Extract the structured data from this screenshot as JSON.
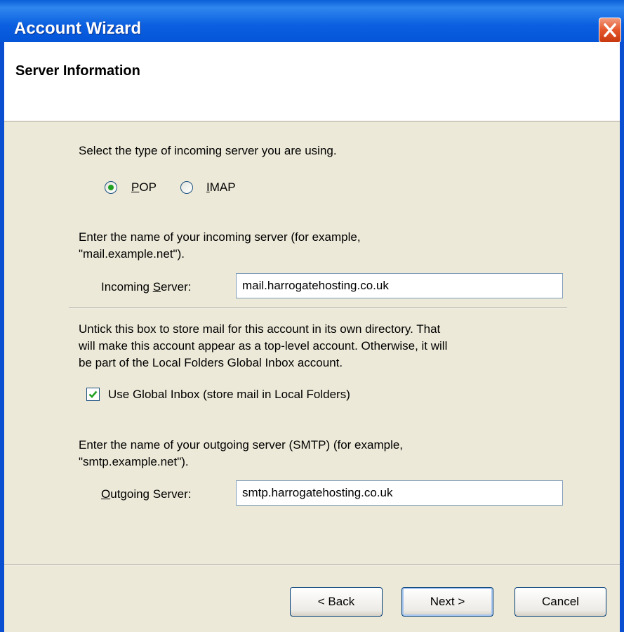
{
  "window": {
    "title": "Account Wizard"
  },
  "header": {
    "title": "Server Information"
  },
  "incoming_type": {
    "prompt": "Select the type of incoming server you are using.",
    "options": [
      {
        "label": "POP",
        "selected": true
      },
      {
        "label": "IMAP",
        "selected": false
      }
    ]
  },
  "incoming": {
    "desc_line1": "Enter the name of your incoming server (for example,",
    "desc_line2": "\"mail.example.net\").",
    "label": "Incoming Server:",
    "value": "mail.harrogatehosting.co.uk"
  },
  "global_inbox": {
    "desc_line1": "Untick this box to store mail for this account in its own directory. That",
    "desc_line2": "will make this account appear as a top-level account. Otherwise, it will",
    "desc_line3": "be part of the Local Folders Global Inbox account.",
    "checkbox_label": "Use Global Inbox (store mail in Local Folders)",
    "checked": true
  },
  "outgoing": {
    "desc_line1": "Enter the name of your outgoing server (SMTP) (for example,",
    "desc_line2": "\"smtp.example.net\").",
    "label": "Outgoing Server:",
    "value": "smtp.harrogatehosting.co.uk"
  },
  "buttons": {
    "back": "< Back",
    "next": "Next >",
    "cancel": "Cancel"
  },
  "colors": {
    "titlebar": "#0a5fd8",
    "dialog_bg": "#ece9d8",
    "radio_dot": "#21a121",
    "check_mark": "#21a121"
  }
}
